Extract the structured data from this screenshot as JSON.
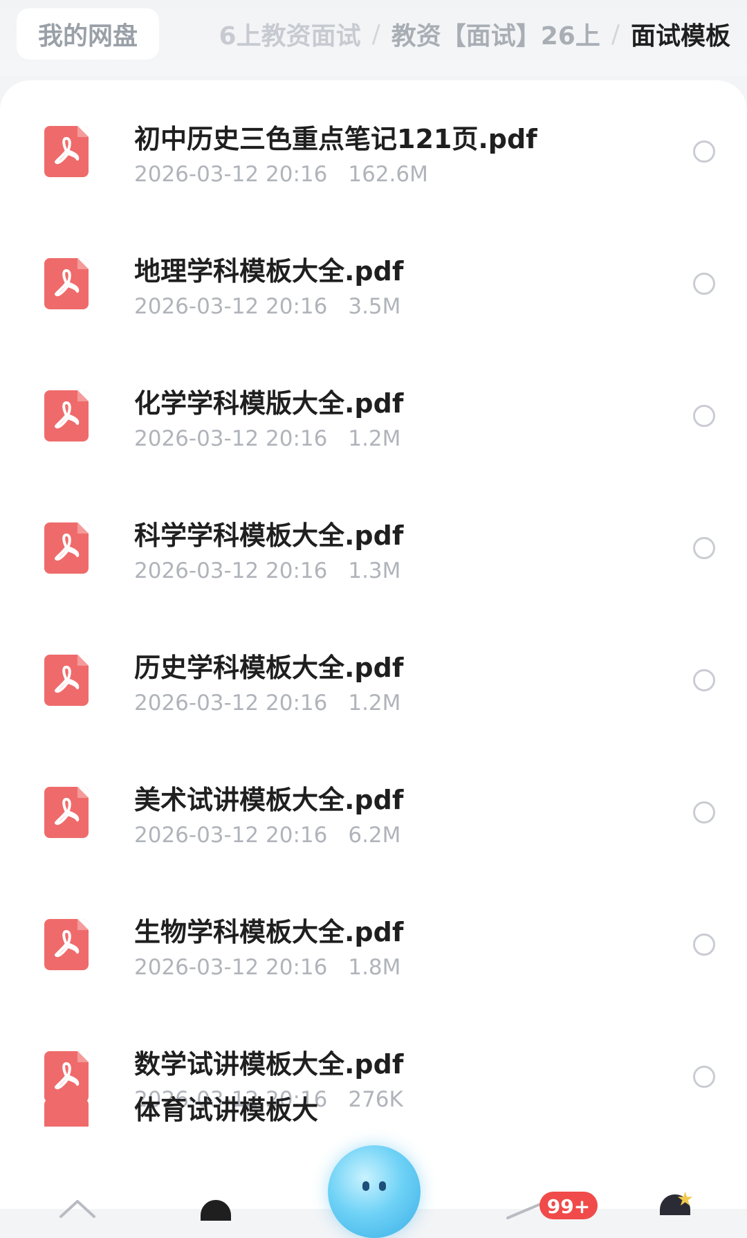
{
  "breadcrumb": {
    "root": "我的网盘",
    "path_partial": "6上教资面试",
    "separator": "/",
    "middle": "教资【面试】26上",
    "current": "面试模板"
  },
  "files": [
    {
      "name": "初中历史三色重点笔记121页.pdf",
      "date": "2026-03-12 20:16",
      "size": "162.6M"
    },
    {
      "name": "地理学科模板大全.pdf",
      "date": "2026-03-12 20:16",
      "size": "3.5M"
    },
    {
      "name": "化学学科模版大全.pdf",
      "date": "2026-03-12 20:16",
      "size": "1.2M"
    },
    {
      "name": "科学学科模板大全.pdf",
      "date": "2026-03-12 20:16",
      "size": "1.3M"
    },
    {
      "name": "历史学科模板大全.pdf",
      "date": "2026-03-12 20:16",
      "size": "1.2M"
    },
    {
      "name": "美术试讲模板大全.pdf",
      "date": "2026-03-12 20:16",
      "size": "6.2M"
    },
    {
      "name": "生物学科模板大全.pdf",
      "date": "2026-03-12 20:16",
      "size": "1.8M"
    },
    {
      "name": "数学试讲模板大全.pdf",
      "date": "2026-03-12 20:16",
      "size": "276K"
    }
  ],
  "partial_file": {
    "name": "体育试讲模板大"
  },
  "tabbar": {
    "badge": "99+",
    "icons": [
      "home-icon",
      "files-icon",
      "assistant-icon",
      "messages-icon",
      "profile-icon"
    ]
  },
  "colors": {
    "pdf": "#ef6b6b",
    "badge": "#f04a4a",
    "assistant": "#6fd2f6"
  }
}
